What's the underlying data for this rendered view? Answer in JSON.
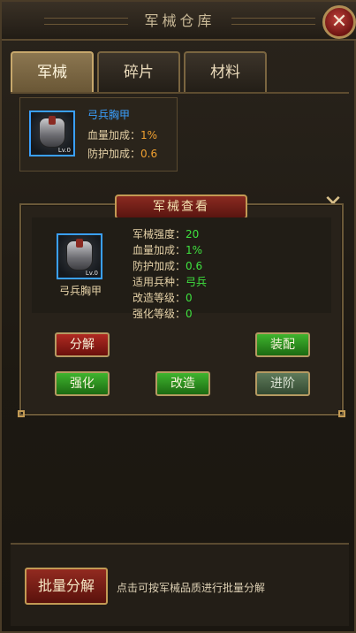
{
  "window": {
    "title": "军械仓库",
    "close_icon": "close-icon"
  },
  "tabs": [
    {
      "label": "军械",
      "active": true
    },
    {
      "label": "碎片",
      "active": false
    },
    {
      "label": "材料",
      "active": false
    }
  ],
  "item": {
    "name": "弓兵胸甲",
    "level": "Lv.0",
    "stats": [
      {
        "label": "血量加成：",
        "value": "1%"
      },
      {
        "label": "防护加成：",
        "value": "0.6"
      }
    ]
  },
  "detail": {
    "header": "军械查看",
    "name": "弓兵胸甲",
    "level": "Lv.0",
    "attributes": [
      {
        "label": "军械强度：",
        "value": "20"
      },
      {
        "label": "血量加成：",
        "value": "1%"
      },
      {
        "label": "防护加成：",
        "value": "0.6"
      },
      {
        "label": "适用兵种：",
        "value": "弓兵"
      },
      {
        "label": "改造等级：",
        "value": "0"
      },
      {
        "label": "强化等级：",
        "value": "0"
      }
    ],
    "buttons": {
      "decompose": "分解",
      "equip": "装配",
      "strengthen": "强化",
      "modify": "改造",
      "advance": "进阶"
    }
  },
  "bottom": {
    "batch_button": "批量分解",
    "hint": "点击可按军械品质进行批量分解"
  },
  "colors": {
    "rarity_blue": "#3aa0ff",
    "value_green": "#3fe23f",
    "value_orange": "#f0a030"
  }
}
